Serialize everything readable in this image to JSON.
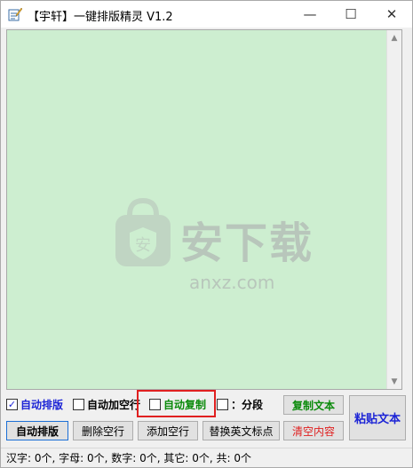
{
  "window": {
    "title": "【宇轩】一键排版精灵 V1.2",
    "controls": {
      "minimize": "—",
      "maximize": "☐",
      "close": "✕"
    }
  },
  "editor": {
    "background": "#cdeed0",
    "watermark": {
      "text": "安下载",
      "sub": "anxz.com",
      "icon": "shield-bag-icon"
    }
  },
  "options": {
    "auto_format": {
      "label": "自动排版",
      "checked": true,
      "check_mark": "✓",
      "color": "#1c24d6"
    },
    "auto_blank_line": {
      "label": "自动加空行",
      "checked": false
    },
    "auto_copy": {
      "label": "自动复制",
      "checked": false,
      "color": "#0a8a0a"
    },
    "segment": {
      "label": "：分段",
      "checked": false
    }
  },
  "buttons": {
    "copy_text": "复制文本",
    "paste_text": "粘贴文本",
    "auto_format": "自动排版",
    "delete_blank": "删除空行",
    "add_blank": "添加空行",
    "replace_punct": "替换英文标点",
    "clear": "清空内容"
  },
  "status": {
    "text": "汉字: 0个, 字母: 0个, 数字: 0个, 其它: 0个, 共: 0个"
  }
}
